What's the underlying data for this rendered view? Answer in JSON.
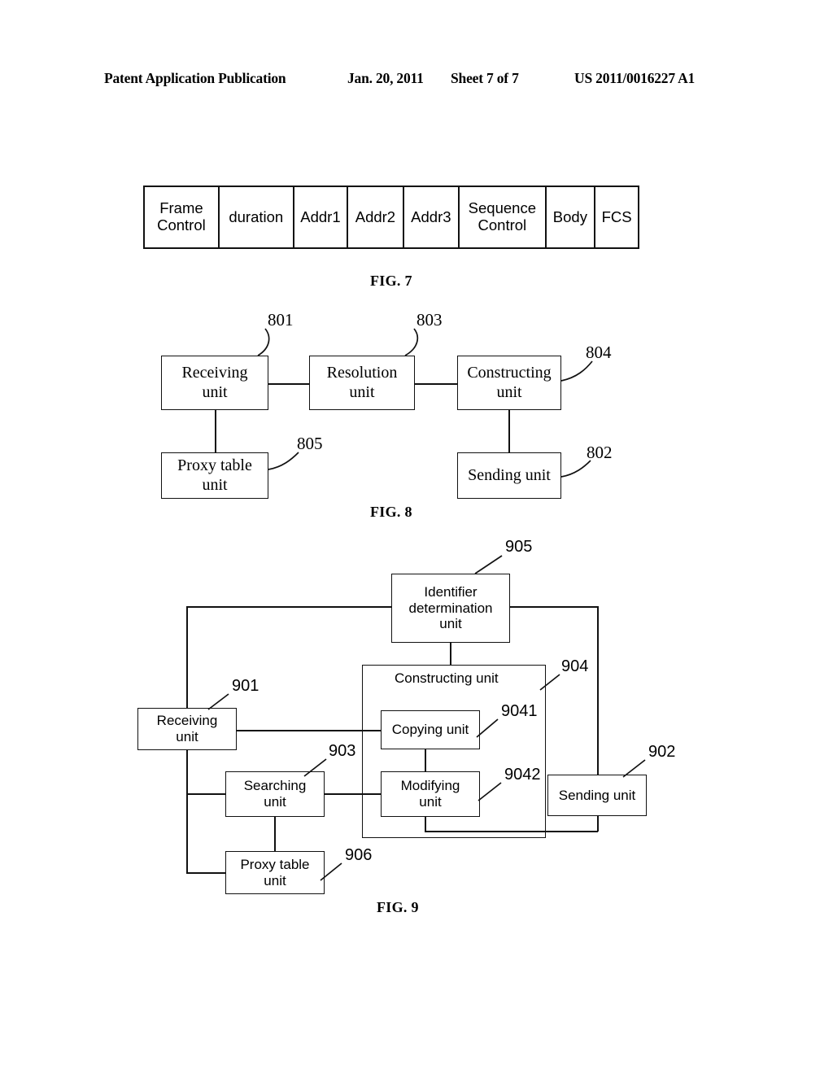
{
  "header": {
    "publication": "Patent Application Publication",
    "date": "Jan. 20, 2011",
    "sheet": "Sheet 7 of 7",
    "number": "US 2011/0016227 A1"
  },
  "figures": [
    {
      "caption": "FIG. 7",
      "type": "frame-format-table",
      "cells": [
        "Frame Control",
        "duration",
        "Addr1",
        "Addr2",
        "Addr3",
        "Sequence Control",
        "Body",
        "FCS"
      ]
    },
    {
      "caption": "FIG. 8",
      "type": "block-diagram",
      "blocks": [
        {
          "label": "Receiving unit",
          "ref": "801"
        },
        {
          "label": "Resolution unit",
          "ref": "803"
        },
        {
          "label": "Constructing unit",
          "ref": "804"
        },
        {
          "label": "Proxy table unit",
          "ref": "805"
        },
        {
          "label": "Sending unit",
          "ref": "802"
        }
      ]
    },
    {
      "caption": "FIG. 9",
      "type": "block-diagram",
      "blocks": [
        {
          "label": "Identifier determination unit",
          "ref": "905"
        },
        {
          "label": "Constructing unit",
          "ref": "904"
        },
        {
          "label": "Receiving unit",
          "ref": "901"
        },
        {
          "label": "Copying unit",
          "ref": "9041"
        },
        {
          "label": "Searching unit",
          "ref": "903"
        },
        {
          "label": "Modifying unit",
          "ref": "9042"
        },
        {
          "label": "Sending unit",
          "ref": "902"
        },
        {
          "label": "Proxy table unit",
          "ref": "906"
        }
      ]
    }
  ],
  "fig7": {
    "cell_1": "Frame",
    "cell_1b": "Control",
    "cell_2": "duration",
    "cell_3": "Addr1",
    "cell_4": "Addr2",
    "cell_5": "Addr3",
    "cell_6": "Sequence",
    "cell_6b": "Control",
    "cell_7": "Body",
    "cell_8": "FCS",
    "caption": "FIG. 7"
  },
  "fig8": {
    "caption": "FIG. 8",
    "receiving_a": "Receiving",
    "receiving_b": "unit",
    "resolution_a": "Resolution",
    "resolution_b": "unit",
    "constructing_a": "Constructing",
    "constructing_b": "unit",
    "proxy_a": "Proxy table",
    "proxy_b": "unit",
    "sending": "Sending unit",
    "ref_801": "801",
    "ref_802": "802",
    "ref_803": "803",
    "ref_804": "804",
    "ref_805": "805"
  },
  "fig9": {
    "caption": "FIG. 9",
    "identifier_a": "Identifier",
    "identifier_b": "determination",
    "identifier_c": "unit",
    "constructing_title": "Constructing unit",
    "receiving_a": "Receiving",
    "receiving_b": "unit",
    "copying": "Copying unit",
    "searching_a": "Searching",
    "searching_b": "unit",
    "modifying_a": "Modifying",
    "modifying_b": "unit",
    "sending": "Sending unit",
    "proxy_a": "Proxy table",
    "proxy_b": "unit",
    "ref_901": "901",
    "ref_902": "902",
    "ref_903": "903",
    "ref_904": "904",
    "ref_905": "905",
    "ref_906": "906",
    "ref_9041": "9041",
    "ref_9042": "9042"
  }
}
